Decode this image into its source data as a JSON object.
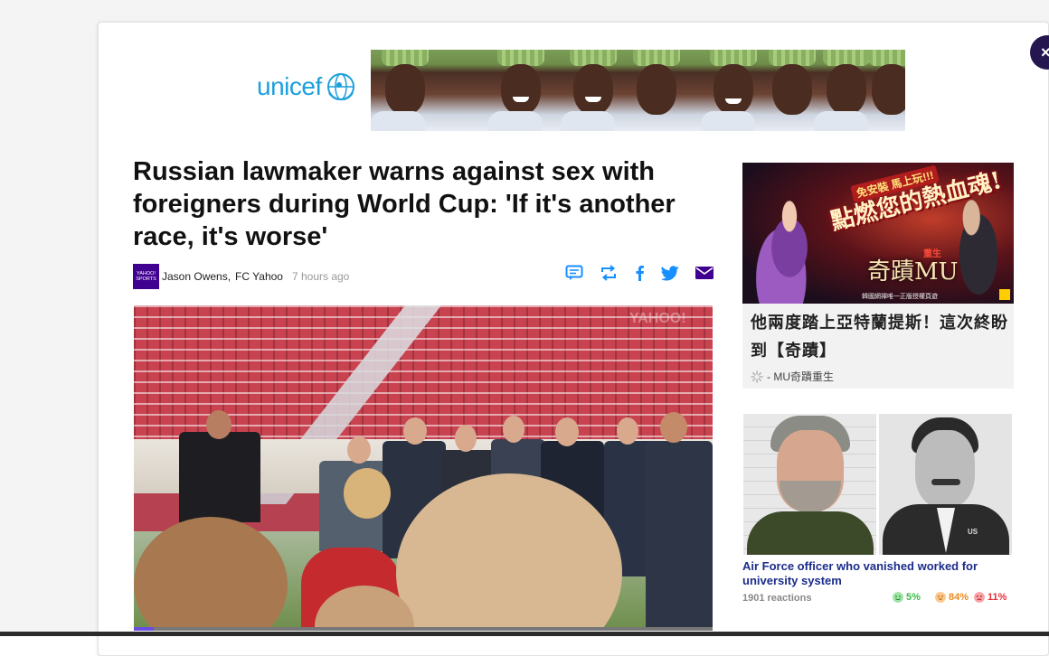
{
  "modal": {
    "close_label": "×"
  },
  "ad": {
    "brand": "unicef"
  },
  "article": {
    "headline": "Russian lawmaker warns against sex with foreigners during World Cup: 'If it's another race, it's worse'",
    "provider_logo_line1": "YAHOO!",
    "provider_logo_line2": "SPORTS",
    "author": "Jason Owens",
    "separator": ",",
    "source": "FC Yahoo",
    "timestamp": "7 hours ago",
    "share_icons": [
      "comment-icon",
      "retweet-icon",
      "facebook-icon",
      "twitter-icon",
      "mail-icon"
    ],
    "video": {
      "watermark": "YAHOO!",
      "progress_fraction": 0.035
    }
  },
  "sidebar": {
    "card1": {
      "badge": "免安裝 馬上玩!!!",
      "art_title": "點燃您的熱血魂!",
      "logo": "奇蹟MU",
      "logo_sub": "重生",
      "fineprint": "韓國網禪唯一正版授權頁遊",
      "title": "他兩度踏上亞特蘭提斯！這次終盼到【奇蹟】",
      "sponsor": "- MU奇蹟重生"
    },
    "card2": {
      "badge_text": "US",
      "title": "Air Force officer who vanished worked for university system",
      "reactions": "1901 reactions",
      "reaction_items": [
        {
          "name": "happy",
          "percent": "5%",
          "color": "#3fba4a"
        },
        {
          "name": "neutral",
          "percent": "84%",
          "color": "#f08a1c"
        },
        {
          "name": "sad",
          "percent": "11%",
          "color": "#e0323b"
        }
      ]
    }
  },
  "colors": {
    "brand_purple": "#400090",
    "share_blue": "#188fff",
    "close_bg": "#26164f"
  }
}
